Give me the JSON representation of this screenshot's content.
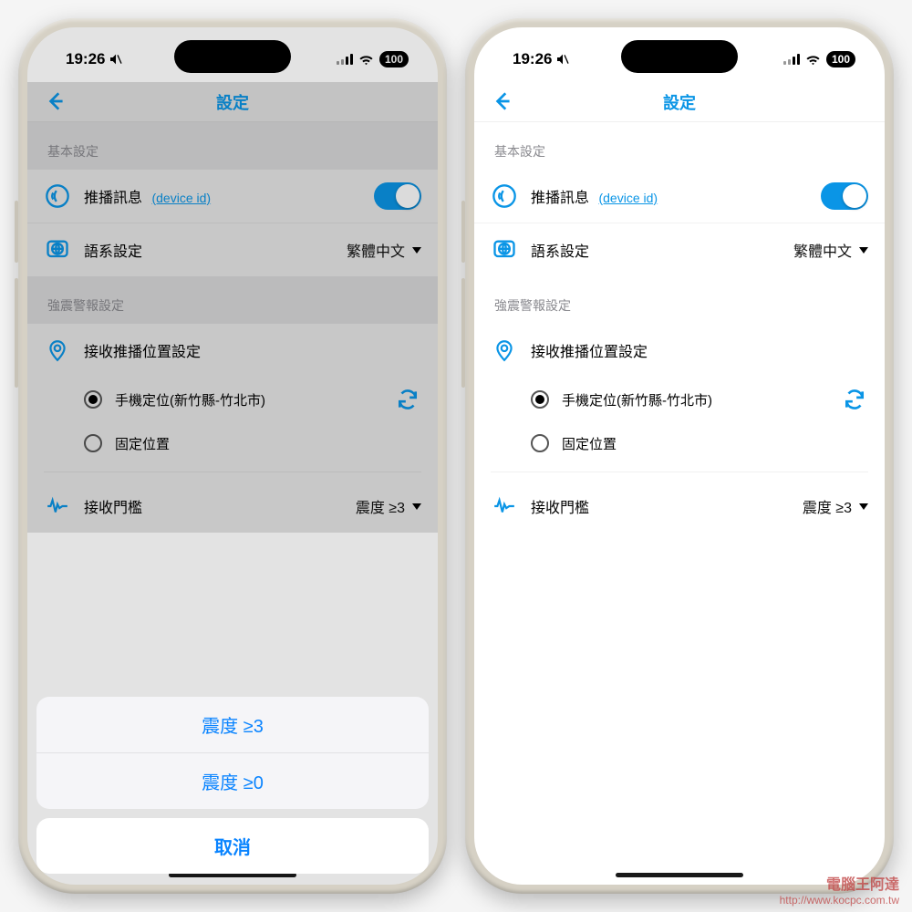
{
  "status": {
    "time": "19:26",
    "battery": "100"
  },
  "nav": {
    "title": "設定"
  },
  "basic": {
    "header": "基本設定",
    "push": {
      "label": "推播訊息",
      "sublink": "(device id)",
      "on": true
    },
    "lang": {
      "label": "語系設定",
      "value": "繁體中文"
    }
  },
  "alert": {
    "header": "強震警報設定",
    "location": {
      "label": "接收推播位置設定",
      "opt1": "手機定位(新竹縣-竹北市)",
      "opt2": "固定位置"
    },
    "threshold": {
      "label": "接收門檻",
      "value": "震度 ≥3"
    }
  },
  "sheet": {
    "opt1": "震度 ≥3",
    "opt2": "震度 ≥0",
    "cancel": "取消"
  },
  "watermark": {
    "title": "電腦王阿達",
    "url": "http://www.kocpc.com.tw"
  }
}
